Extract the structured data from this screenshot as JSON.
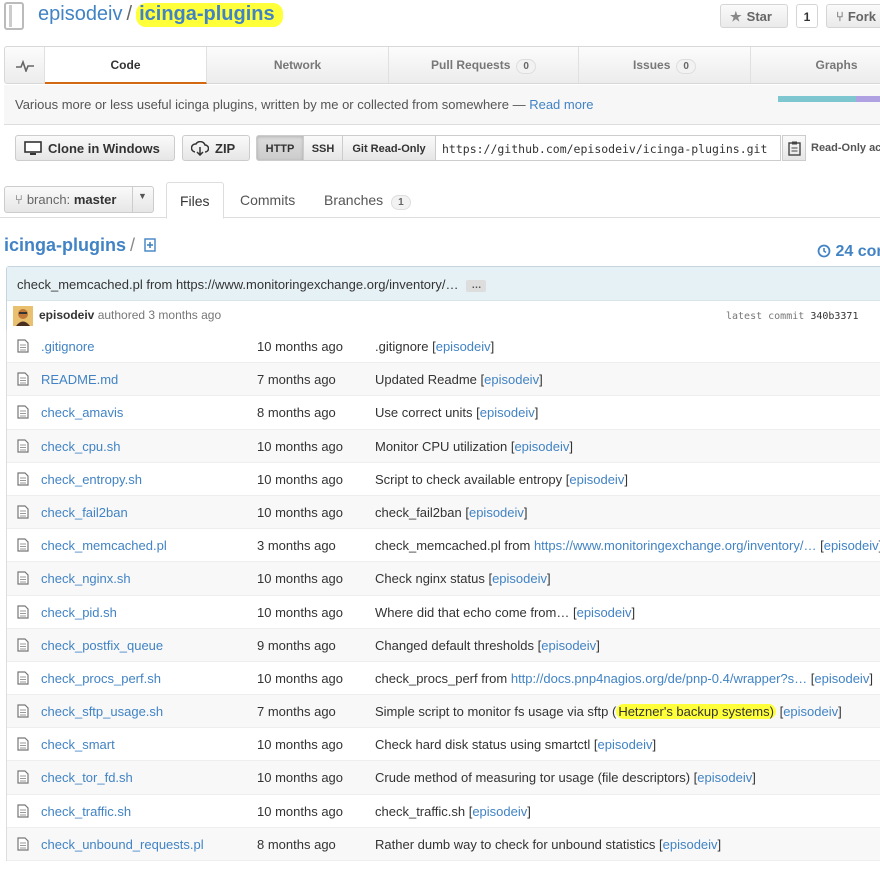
{
  "header": {
    "owner": "episodeiv",
    "separator": "/",
    "repo": "icinga-plugins",
    "star_label": "Star",
    "star_count": "1",
    "fork_label": "Fork"
  },
  "nav": {
    "tabs": [
      {
        "label": "Code",
        "selected": true
      },
      {
        "label": "Network"
      },
      {
        "label": "Pull Requests",
        "count": "0"
      },
      {
        "label": "Issues",
        "count": "0"
      },
      {
        "label": "Graphs"
      }
    ]
  },
  "description": {
    "text": "Various more or less useful icinga plugins, written by me or collected from somewhere — ",
    "read_more": "Read more"
  },
  "colors": {
    "accent": "#4183c4",
    "highlight": "#ffff3a",
    "tab_underline": "#d26911"
  },
  "clone": {
    "windows_label": "Clone in Windows",
    "zip_label": "ZIP",
    "protocols": [
      "HTTP",
      "SSH",
      "Git Read-Only"
    ],
    "url": "https://github.com/episodeiv/icinga-plugins.git",
    "access_note": "Read-Only ac"
  },
  "branch": {
    "prefix": "branch:",
    "name": "master"
  },
  "file_tabs": {
    "files": "Files",
    "commits": "Commits",
    "branches": "Branches",
    "branches_count": "1"
  },
  "breadcrumb": {
    "root": "icinga-plugins",
    "slash": "/"
  },
  "commits_count": "24 com",
  "latest_commit": {
    "message": "check_memcached.pl from https://www.monitoringexchange.org/inventory/…",
    "ellipsis": "…",
    "author": "episodeiv",
    "authored_text": "authored 3 months ago",
    "sha_label": "latest commit",
    "sha": "340b3371"
  },
  "files": [
    {
      "name": ".gitignore",
      "age": "10 months ago",
      "msg": ".gitignore",
      "author": "episodeiv"
    },
    {
      "name": "README.md",
      "age": "7 months ago",
      "msg": "Updated Readme",
      "author": "episodeiv"
    },
    {
      "name": "check_amavis",
      "age": "8 months ago",
      "msg": "Use correct units",
      "author": "episodeiv"
    },
    {
      "name": "check_cpu.sh",
      "age": "10 months ago",
      "msg": "Monitor CPU utilization",
      "author": "episodeiv"
    },
    {
      "name": "check_entropy.sh",
      "age": "10 months ago",
      "msg": "Script to check available entropy",
      "author": "episodeiv"
    },
    {
      "name": "check_fail2ban",
      "age": "10 months ago",
      "msg": "check_fail2ban",
      "author": "episodeiv"
    },
    {
      "name": "check_memcached.pl",
      "age": "3 months ago",
      "msg": "check_memcached.pl from ",
      "link": "https://www.monitoringexchange.org/inventory/…",
      "author": "episodeiv"
    },
    {
      "name": "check_nginx.sh",
      "age": "10 months ago",
      "msg": "Check nginx status",
      "author": "episodeiv"
    },
    {
      "name": "check_pid.sh",
      "age": "10 months ago",
      "msg": "Where did that echo come from…",
      "author": "episodeiv"
    },
    {
      "name": "check_postfix_queue",
      "age": "9 months ago",
      "msg": "Changed default thresholds",
      "author": "episodeiv"
    },
    {
      "name": "check_procs_perf.sh",
      "age": "10 months ago",
      "msg": "check_procs_perf from ",
      "link": "http://docs.pnp4nagios.org/de/pnp-0.4/wrapper?s…",
      "author": "episodeiv"
    },
    {
      "name": "check_sftp_usage.sh",
      "age": "7 months ago",
      "msg": "Simple script to monitor fs usage via sftp (",
      "highlight": "Hetzner's backup systems)",
      "author": "episodeiv"
    },
    {
      "name": "check_smart",
      "age": "10 months ago",
      "msg": "Check hard disk status using smartctl",
      "author": "episodeiv"
    },
    {
      "name": "check_tor_fd.sh",
      "age": "10 months ago",
      "msg": "Crude method of measuring tor usage (file descriptors)",
      "author": "episodeiv"
    },
    {
      "name": "check_traffic.sh",
      "age": "10 months ago",
      "msg": "check_traffic.sh",
      "author": "episodeiv"
    },
    {
      "name": "check_unbound_requests.pl",
      "age": "8 months ago",
      "msg": "Rather dumb way to check for unbound statistics",
      "author": "episodeiv"
    }
  ]
}
